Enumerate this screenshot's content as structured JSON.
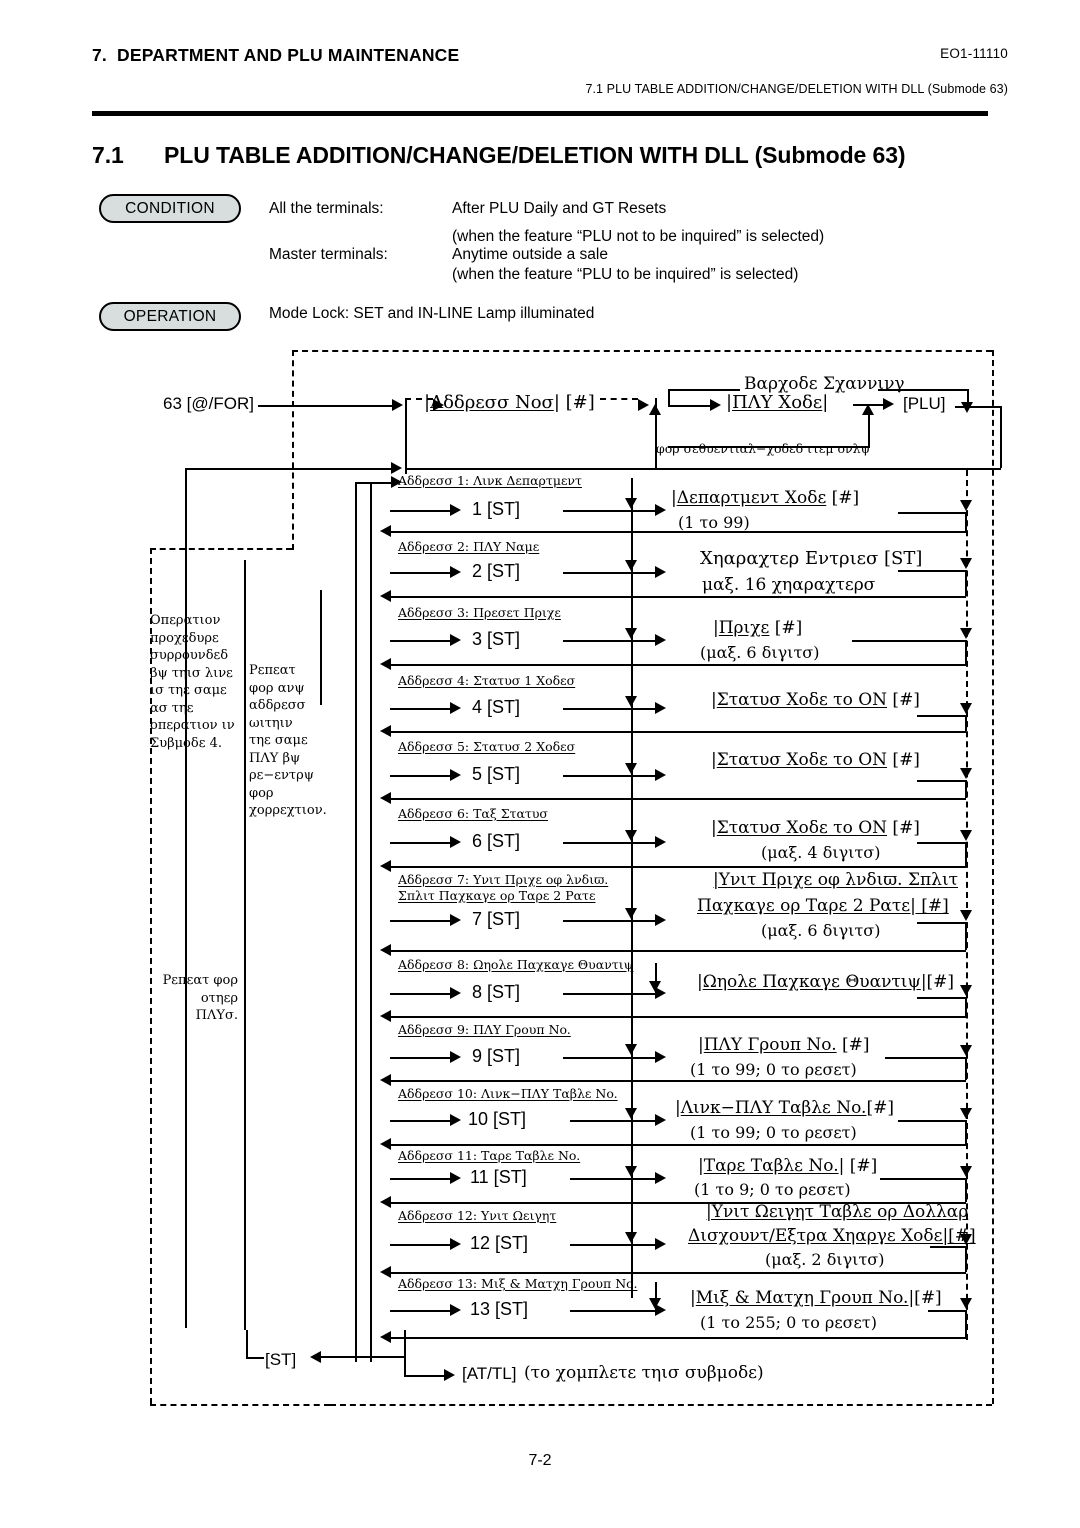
{
  "header": {
    "chapter_num": "7.",
    "chapter_title": "DEPARTMENT AND PLU MAINTENANCE",
    "doc_code": "EO1-11110",
    "running_head": "7.1  PLU TABLE ADDITION/CHANGE/DELETION WITH DLL (Submode 63)"
  },
  "title": {
    "number": "7.1",
    "text": "PLU TABLE ADDITION/CHANGE/DELETION WITH DLL (Submode 63)"
  },
  "condition": {
    "pill_label": "CONDITION",
    "rows": [
      {
        "label": "All the terminals:",
        "value": "After PLU Daily and GT Resets"
      },
      {
        "label": "",
        "value": "(when the feature “PLU not to be inquired” is selected)"
      },
      {
        "label": "Master terminals:",
        "value": "Anytime outside a sale"
      },
      {
        "label": "",
        "value": "(when the feature “PLU to be inquired” is selected)"
      }
    ]
  },
  "operation": {
    "pill_label": "OPERATION",
    "text": "Mode Lock:  SET and IN-LINE Lamp illuminated"
  },
  "flow": {
    "entry_key": "63 [@/FOR]",
    "address_no": "|Αδδρεσσ Νοσ| [#]",
    "address_no_underlined": "Αδδρεσσ Νοσ",
    "barcode_scanning": "Βαρχοδε Σχαννινγ",
    "plu_code": "|ΠΛΥ Χοδε|",
    "plu_code_underlined": "ΠΛΥ Χοδε",
    "plu_key": "[PLU]",
    "sequential_note": "φορ σεθυεντιαλ−χοδεδ ιτεμ ονλψ",
    "final_st": "[ST]",
    "final_attl": "[AT/TL]",
    "final_attl_note": "(το χομπλετε τηισ συβμοδε)"
  },
  "notes": {
    "operation_procedure": "Οπερατιον προχεδυρε συρρουνδεδ βψ τηισ λινε ισ τηε σαμε ασ τηε οπερατιον ιν Συβμοδε 4.",
    "repeat_any_address": "Ρεπεατ φορ ανψ αδδρεσσ ωιτηιν τηε σαμε ΠΛΥ βψ ρε−εντρψ φορ χορρεχτιον.",
    "repeat_other_plus": "Ρεπεατ φορ οτηερ ΠΛΥσ."
  },
  "rows": [
    {
      "n": "1",
      "step_key": "1   [ST]",
      "addr_label": "Αδδρεσσ 1:  Λινκ Δεπαρτμεντ",
      "entry_main": "|Δεπαρτμεντ Χοδε|   [#]",
      "entry_ul": "Δεπαρτμεντ Χοδε",
      "entry_tail": "   [#]",
      "entry_sub": "(1 το 99)"
    },
    {
      "n": "2",
      "step_key": "2   [ST]",
      "addr_label": "Αδδρεσσ 2:  ΠΛΥ Ναμε",
      "entry_main": "Χηαραχτερ Εντριεσ [ST]",
      "entry_ul": "",
      "entry_tail": "",
      "entry_sub": "μαξ. 16 χηαραχτερσ"
    },
    {
      "n": "3",
      "step_key": "3   [ST]",
      "addr_label": "Αδδρεσσ 3:  Πρεσετ Πριχε",
      "entry_main": "|Πριχε| [#]",
      "entry_ul": "Πριχε",
      "entry_tail": " [#]",
      "entry_sub": "(μαξ. 6 διγιτσ)"
    },
    {
      "n": "4",
      "step_key": "4   [ST]",
      "addr_label": "Αδδρεσσ 4:  Στατυσ 1 Χοδεσ",
      "entry_main": "|Στατυσ Χοδε το ON| [#]",
      "entry_ul": "Στατυσ Χοδε το ON",
      "entry_tail": " [#]",
      "entry_sub": ""
    },
    {
      "n": "5",
      "step_key": "5   [ST]",
      "addr_label": "Αδδρεσσ 5:  Στατυσ 2 Χοδεσ",
      "entry_main": "|Στατυσ Χοδε το ON| [#]",
      "entry_ul": "Στατυσ Χοδε το ON",
      "entry_tail": " [#]",
      "entry_sub": ""
    },
    {
      "n": "6",
      "step_key": "6   [ST]",
      "addr_label": "Αδδρεσσ 6:  Ταξ Στατυσ",
      "entry_main": "|Στατυσ Χοδε το ON| [#]",
      "entry_ul": "Στατυσ Χοδε το ON",
      "entry_tail": " [#]",
      "entry_sub": "(μαξ. 4 διγιτσ)"
    },
    {
      "n": "7",
      "step_key": "7   [ST]",
      "addr_label": "Αδδρεσσ 7:  Υνιτ Πριχε οφ λνδιϖ.",
      "addr_label2": "Σπλιτ Παχκαγε ορ Ταρε 2 Ρατε",
      "entry_main": "|Υνιτ Πριχε οφ λνδιϖ. Σπλιτ",
      "entry_main2": "Παχκαγε ορ Ταρε 2 Ρατε| [#]",
      "entry_ul": "",
      "entry_tail": "",
      "entry_sub": "(μαξ. 6 διγιτσ)"
    },
    {
      "n": "8",
      "step_key": "8   [ST]",
      "addr_label": "Αδδρεσσ 8:  Ωηολε Παχκαγε Θυαντιψ",
      "entry_main": "|Ωηολε Παχκαγε Θυαντιψ|[#]",
      "entry_ul": "Ωηολε Παχκαγε Θυαντιψ",
      "entry_tail": "|[#]",
      "entry_sub": ""
    },
    {
      "n": "9",
      "step_key": "9   [ST]",
      "addr_label": "Αδδρεσσ 9:  ΠΛΥ Γρουπ No.",
      "entry_main": "|ΠΛΥ Γρουπ No.|  [#]",
      "entry_ul": "ΠΛΥ Γρουπ No.",
      "entry_tail": "  [#]",
      "entry_sub": "(1 το 99;  0 το ρεσετ)"
    },
    {
      "n": "10",
      "step_key": "10   [ST]",
      "addr_label": "Αδδρεσσ 10:  Λινκ−ΠΛΥ Ταβλε No.",
      "entry_main": "|Λινκ−ΠΛΥ Ταβλε No.[#]",
      "entry_ul": "Λινκ−ΠΛΥ Ταβλε No.",
      "entry_tail": "[#]",
      "entry_sub": "(1 το 99;  0 το ρεσετ)"
    },
    {
      "n": "11",
      "step_key": "11   [ST]",
      "addr_label": "Αδδρεσσ 11:  Ταρε Ταβλε No.",
      "entry_main": "|Ταρε Ταβλε No.| [#]",
      "entry_ul": "Ταρε Ταβλε No.",
      "entry_tail": "| [#]",
      "entry_sub": "(1 το 9;  0 το ρεσετ)"
    },
    {
      "n": "12",
      "step_key": "12   [ST]",
      "addr_label": "Αδδρεσσ 12:  Υνιτ Ωειγητ",
      "entry_main": "|Υνιτ Ωειγητ Ταβλε ορ Δολλαρ",
      "entry_main2": "Δισχουντ/Εξτρα Χηαργε Χοδε|[#]",
      "entry_ul": "",
      "entry_tail": "",
      "entry_sub": "(μαξ. 2 διγιτσ)"
    },
    {
      "n": "13",
      "step_key": "13   [ST]",
      "addr_label": "Αδδρεσσ 13:  Μιξ & Ματχη Γρουπ No.",
      "entry_main": "|Μιξ & Ματχη Γρουπ No.|[#]",
      "entry_ul": "Μιξ & Ματχη Γρουπ No.",
      "entry_tail": "|[#]",
      "entry_sub": "(1 το 255;  0 το ρεσετ)"
    }
  ],
  "footer": {
    "page_number": "7-2"
  }
}
